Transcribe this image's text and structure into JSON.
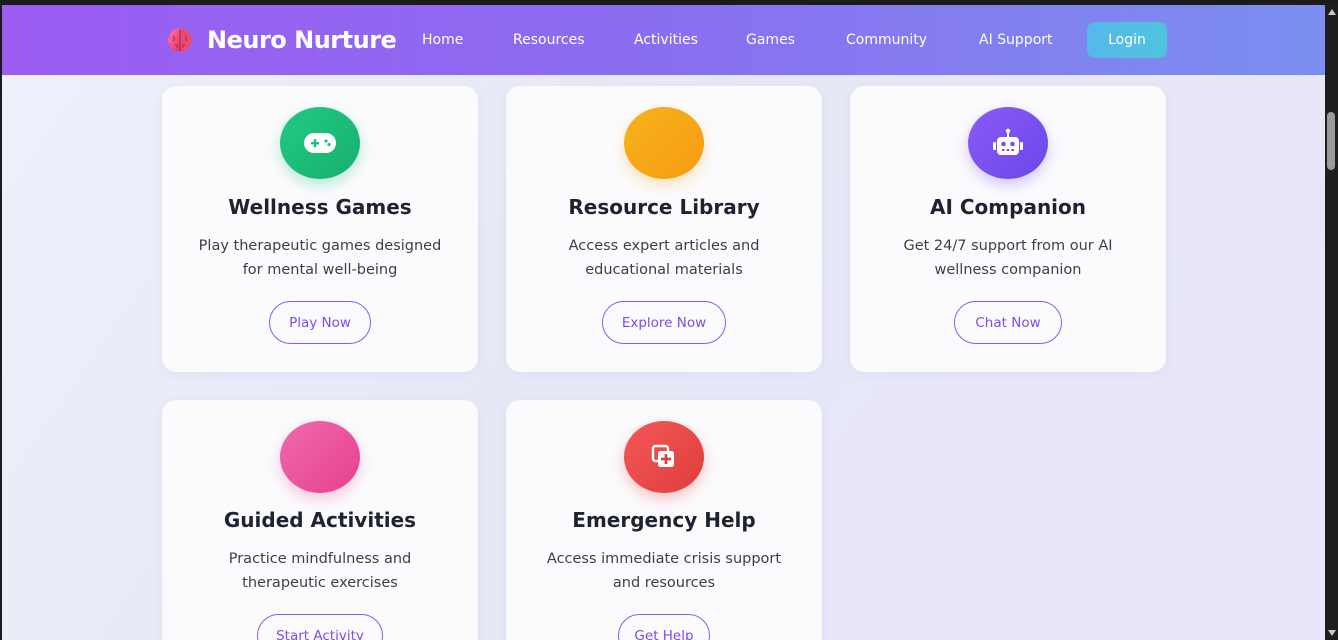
{
  "brand": {
    "name": "Neuro Nurture",
    "icon": "brain-icon"
  },
  "nav": {
    "links": [
      "Home",
      "Resources",
      "Activities",
      "Games",
      "Community",
      "AI Support"
    ],
    "login": "Login"
  },
  "colors": {
    "nav_gradient_start": "#9c5cf2",
    "nav_gradient_end": "#7b8ff0",
    "button_accent": "#8a5cf0",
    "login_button": "#56b8ec"
  },
  "cards": [
    {
      "title": "Wellness Games",
      "desc_line1": "Play therapeutic games designed",
      "desc_line2": "for mental well-being",
      "button": "Play Now",
      "icon": "gamepad-icon",
      "color": "#1fbf7a"
    },
    {
      "title": "Resource Library",
      "desc_line1": "Access expert articles and",
      "desc_line2": "educational materials",
      "button": "Explore Now",
      "icon": "book-icon",
      "color": "#f5a416"
    },
    {
      "title": "AI Companion",
      "desc_line1": "Get 24/7 support from our AI",
      "desc_line2": "wellness companion",
      "button": "Chat Now",
      "icon": "robot-icon",
      "color": "#7a4ff0"
    },
    {
      "title": "Guided Activities",
      "desc_line1": "Practice mindfulness and",
      "desc_line2": "therapeutic exercises",
      "button": "Start Activity",
      "icon": "lotus-icon",
      "color": "#ec4f9d"
    },
    {
      "title": "Emergency Help",
      "desc_line1": "Access immediate crisis support",
      "desc_line2": "and resources",
      "button": "Get Help",
      "icon": "first-aid-icon",
      "color": "#ea4545"
    }
  ]
}
